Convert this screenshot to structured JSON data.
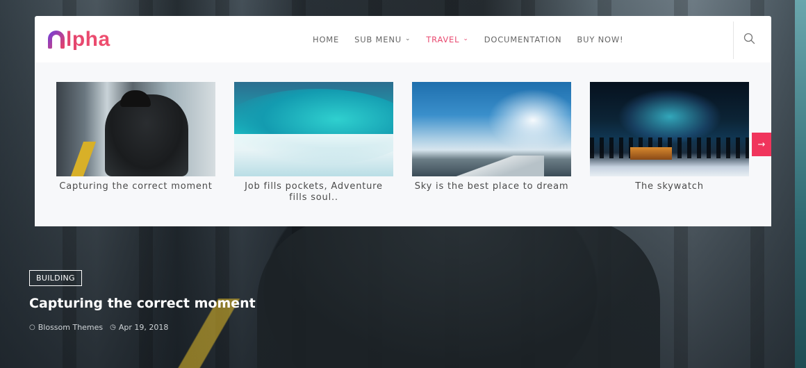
{
  "header": {
    "logo_text": "lpha",
    "nav": [
      {
        "label": "HOME",
        "has_dropdown": false,
        "active": false
      },
      {
        "label": "SUB MENU",
        "has_dropdown": true,
        "active": false
      },
      {
        "label": "TRAVEL",
        "has_dropdown": true,
        "active": true
      },
      {
        "label": "DOCUMENTATION",
        "has_dropdown": false,
        "active": false
      },
      {
        "label": "BUY NOW!",
        "has_dropdown": false,
        "active": false
      }
    ],
    "search_icon": "search-icon",
    "accent_color": "#e8496f"
  },
  "mega_menu": {
    "cards": [
      {
        "title": "Capturing the correct moment"
      },
      {
        "title": "Job fills pockets, Adventure fills soul.."
      },
      {
        "title": "Sky is the best place to dream"
      },
      {
        "title": "The skywatch"
      }
    ],
    "next_icon": "arrow-right-icon",
    "next_color": "#f0355c"
  },
  "hero": {
    "category": "BUILDING",
    "title": "Capturing the correct moment",
    "author": "Blossom Themes",
    "date": "Apr 19, 2018"
  }
}
